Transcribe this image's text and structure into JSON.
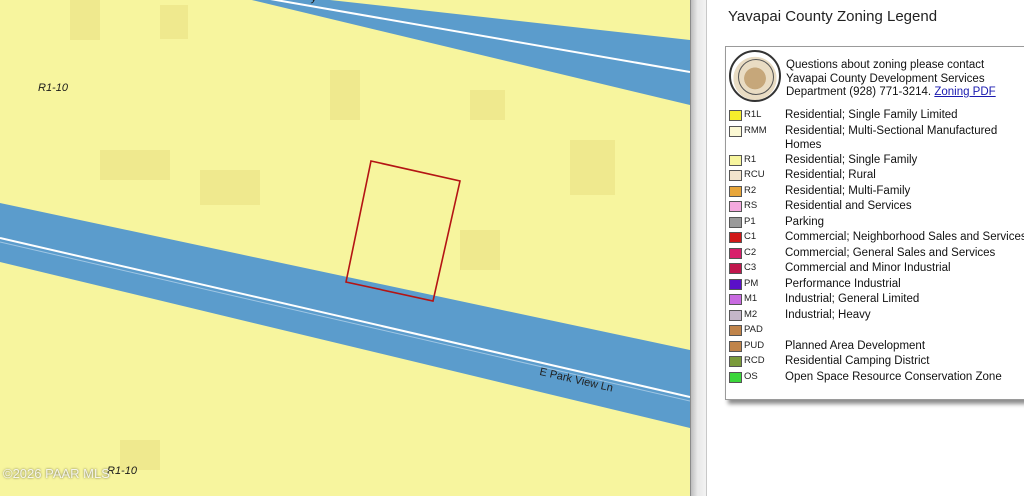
{
  "map": {
    "zone_labels": [
      "R1-10",
      "R1-10"
    ],
    "street_label": "E Park View Ln",
    "top_street_fragment": "y",
    "watermark": "©2026 PAAR MLS",
    "colors": {
      "background": "#f7f59e",
      "road": "#5b9ccc",
      "parcel_outline": "#b41414"
    }
  },
  "legend": {
    "title": "Yavapai County Zoning Legend",
    "seal_icon": "county-seal",
    "contact_text": "Questions about zoning please contact Yavapai County Development Services Department (928) 771-3214.",
    "contact_link": "Zoning PDF",
    "items": [
      {
        "code": "R1L",
        "label": "Residential; Single Family Limited",
        "color": "#f5ee2c"
      },
      {
        "code": "RMM",
        "label": "Residential; Multi-Sectional Manufactured Homes",
        "color": "#fbf8d3"
      },
      {
        "code": "R1",
        "label": "Residential; Single Family",
        "color": "#f7f59e"
      },
      {
        "code": "RCU",
        "label": "Residential; Rural",
        "color": "#f3e4cc"
      },
      {
        "code": "R2",
        "label": "Residential; Multi-Family",
        "color": "#e8a63a"
      },
      {
        "code": "RS",
        "label": "Residential and Services",
        "color": "#f4a9de"
      },
      {
        "code": "P1",
        "label": "Parking",
        "color": "#9a9a9a"
      },
      {
        "code": "C1",
        "label": "Commercial; Neighborhood Sales and Services",
        "color": "#d01818"
      },
      {
        "code": "C2",
        "label": "Commercial; General Sales and Services",
        "color": "#d81e6b"
      },
      {
        "code": "C3",
        "label": "Commercial and Minor Industrial",
        "color": "#c0164c"
      },
      {
        "code": "PM",
        "label": "Performance Industrial",
        "color": "#5a10c8"
      },
      {
        "code": "M1",
        "label": "Industrial; General Limited",
        "color": "#c86ae0"
      },
      {
        "code": "M2",
        "label": "Industrial; Heavy",
        "color": "#c4b6c8"
      },
      {
        "code": "PAD",
        "label": "",
        "color": "#c0844a"
      },
      {
        "code": "PUD",
        "label": "Planned Area Development",
        "color": "#c0844a"
      },
      {
        "code": "RCD",
        "label": "Residential Camping District",
        "color": "#7a9a3a"
      },
      {
        "code": "OS",
        "label": "Open Space Resource Conservation Zone",
        "color": "#3ad63a"
      }
    ]
  }
}
